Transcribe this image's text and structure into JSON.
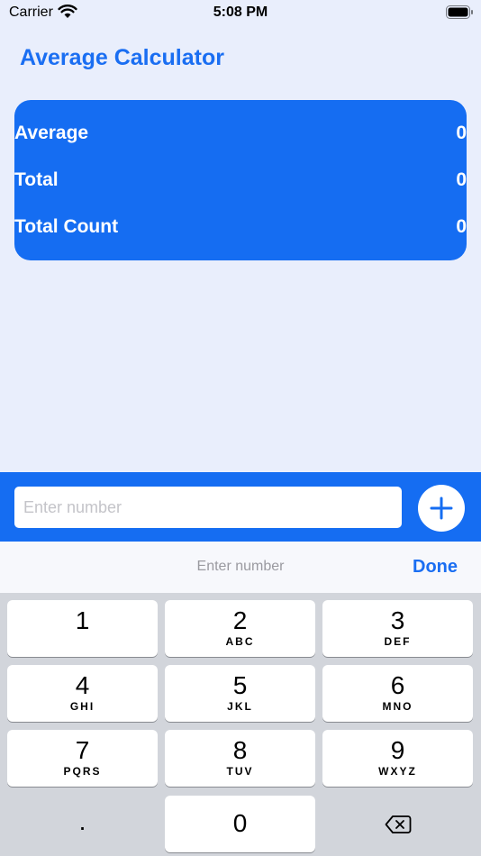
{
  "status_bar": {
    "carrier": "Carrier",
    "time": "5:08 PM",
    "wifi_icon": "wifi-icon",
    "battery_icon": "battery-icon"
  },
  "title": "Average Calculator",
  "stats": [
    {
      "label": "Average",
      "value": "0"
    },
    {
      "label": "Total",
      "value": "0"
    },
    {
      "label": "Total Count",
      "value": "0"
    }
  ],
  "input": {
    "placeholder": "Enter number",
    "value": ""
  },
  "add_icon": "plus-icon",
  "accessory": {
    "placeholder": "Enter number",
    "done_label": "Done"
  },
  "keypad": {
    "keys": [
      {
        "digit": "1",
        "letters": ""
      },
      {
        "digit": "2",
        "letters": "ABC"
      },
      {
        "digit": "3",
        "letters": "DEF"
      },
      {
        "digit": "4",
        "letters": "GHI"
      },
      {
        "digit": "5",
        "letters": "JKL"
      },
      {
        "digit": "6",
        "letters": "MNO"
      },
      {
        "digit": "7",
        "letters": "PQRS"
      },
      {
        "digit": "8",
        "letters": "TUV"
      },
      {
        "digit": "9",
        "letters": "WXYZ"
      }
    ],
    "dot": ".",
    "zero": "0",
    "delete_icon": "delete-backspace-icon"
  },
  "colors": {
    "accent": "#156df2",
    "background": "#e9eefc",
    "keyboard": "#d2d5db"
  }
}
